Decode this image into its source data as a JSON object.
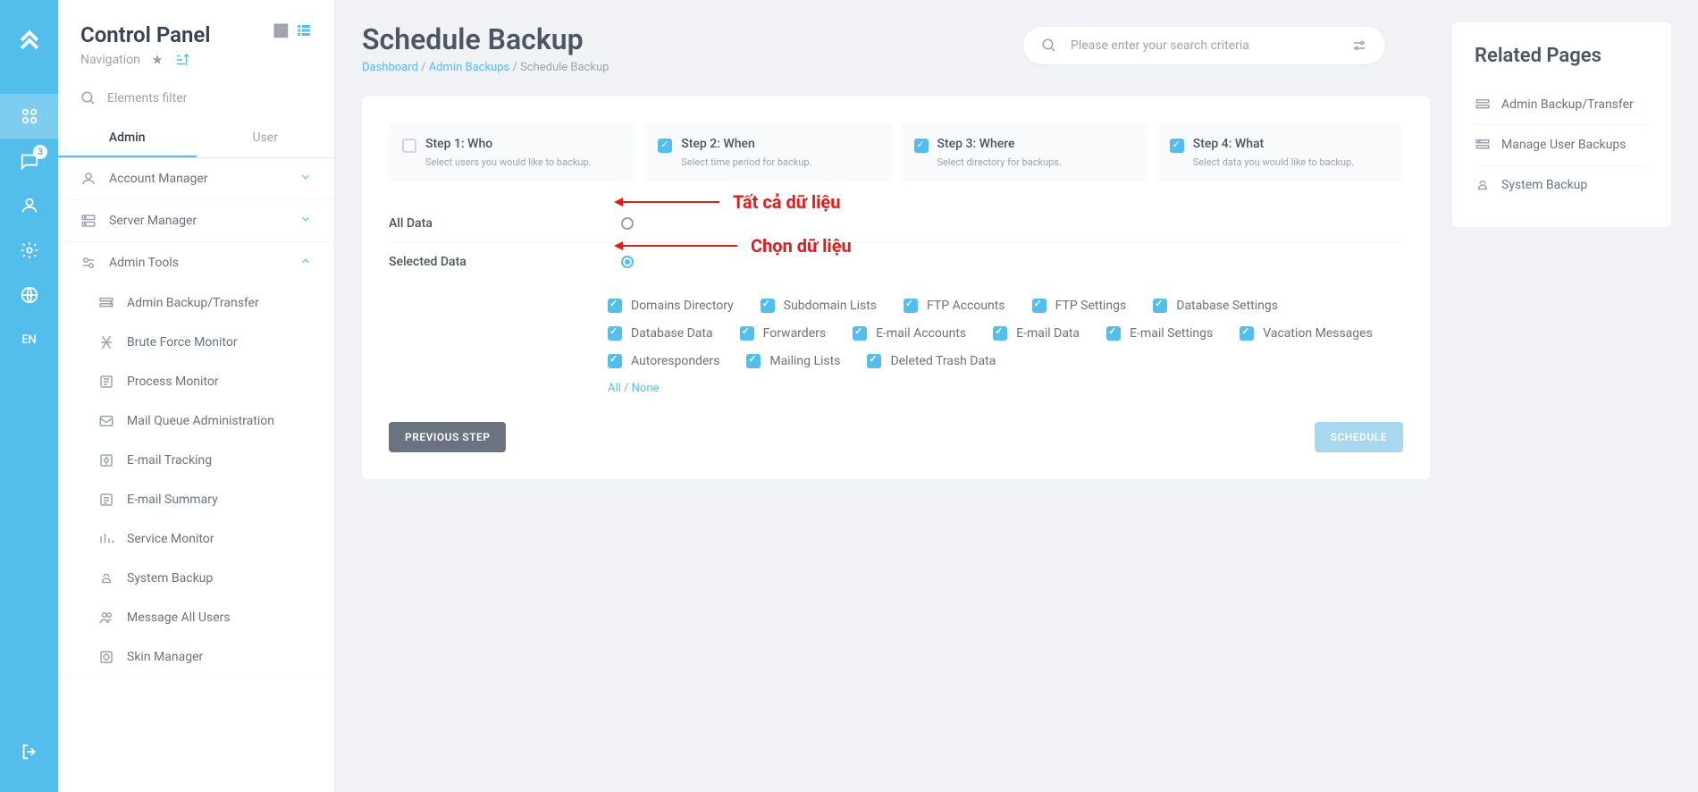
{
  "rail": {
    "badge": "3",
    "lang": "EN"
  },
  "sidebar": {
    "title": "Control Panel",
    "subtitle": "Navigation",
    "search_placeholder": "Elements filter",
    "tabs": {
      "admin": "Admin",
      "user": "User"
    },
    "groups": {
      "account": "Account Manager",
      "server": "Server Manager",
      "tools": "Admin Tools"
    },
    "tools_items": [
      "Admin Backup/Transfer",
      "Brute Force Monitor",
      "Process Monitor",
      "Mail Queue Administration",
      "E-mail Tracking",
      "E-mail Summary",
      "Service Monitor",
      "System Backup",
      "Message All Users",
      "Skin Manager"
    ]
  },
  "page": {
    "title": "Schedule Backup",
    "crumb_dash": "Dashboard",
    "crumb_backups": "Admin Backups",
    "crumb_current": "Schedule Backup"
  },
  "search": {
    "placeholder": "Please enter your search criteria"
  },
  "steps": [
    {
      "title": "Step 1: Who",
      "desc": "Select users you would like to backup.",
      "checked": false
    },
    {
      "title": "Step 2: When",
      "desc": "Select time period for backup.",
      "checked": true
    },
    {
      "title": "Step 3: Where",
      "desc": "Select directory for backups.",
      "checked": true
    },
    {
      "title": "Step 4: What",
      "desc": "Select data you would like to backup.",
      "checked": true
    }
  ],
  "radios": {
    "all": "All Data",
    "selected": "Selected Data"
  },
  "annotations": {
    "all": "Tất cả dữ liệu",
    "selected": "Chọn dữ liệu"
  },
  "checkboxes": [
    "Domains Directory",
    "Subdomain Lists",
    "FTP Accounts",
    "FTP Settings",
    "Database Settings",
    "Database Data",
    "Forwarders",
    "E-mail Accounts",
    "E-mail Data",
    "E-mail Settings",
    "Vacation Messages",
    "Autoresponders",
    "Mailing Lists",
    "Deleted Trash Data"
  ],
  "allnone": {
    "all": "All",
    "none": "None"
  },
  "buttons": {
    "prev": "PREVIOUS STEP",
    "schedule": "SCHEDULE"
  },
  "related": {
    "title": "Related Pages",
    "items": [
      "Admin Backup/Transfer",
      "Manage User Backups",
      "System Backup"
    ]
  }
}
